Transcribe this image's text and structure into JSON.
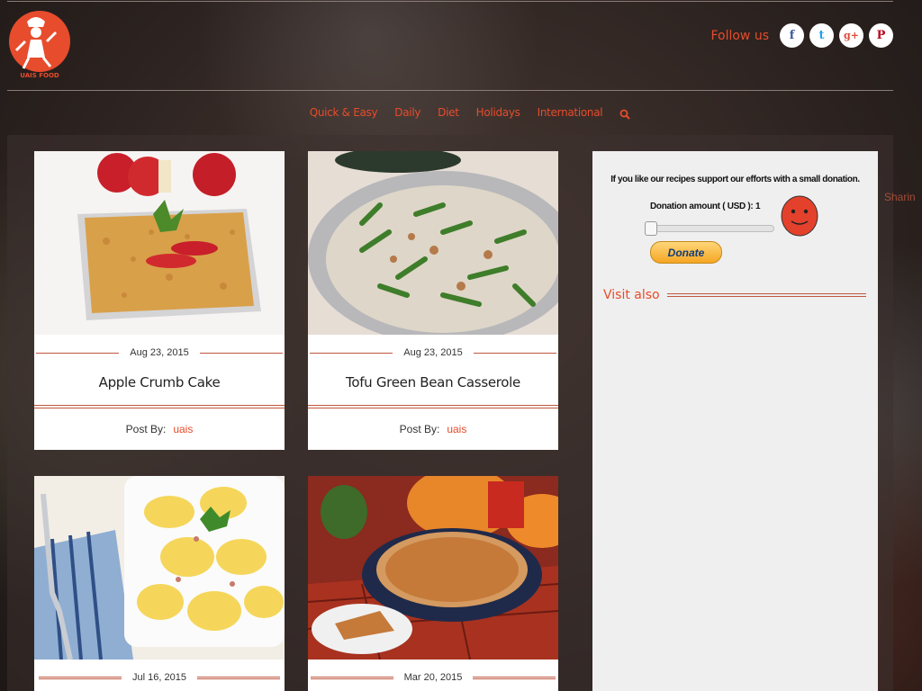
{
  "header": {
    "logo_text": "UAIS FOOD RECIPES",
    "follow_label": "Follow us",
    "social": [
      {
        "name": "facebook",
        "glyph": "f",
        "color": "#3b5998"
      },
      {
        "name": "twitter",
        "glyph": "t",
        "color": "#1da1f2"
      },
      {
        "name": "google-plus",
        "glyph": "g+",
        "color": "#dd4b39"
      },
      {
        "name": "pinterest",
        "glyph": "P",
        "color": "#bd081c"
      }
    ]
  },
  "nav": {
    "items": [
      "Quick & Easy",
      "Daily",
      "Diet",
      "Holidays",
      "International"
    ]
  },
  "posts": [
    {
      "date": "Aug 23, 2015",
      "title": "Apple Crumb Cake",
      "post_by": "Post By:",
      "author": "uais"
    },
    {
      "date": "Aug 23, 2015",
      "title": "Tofu Green Bean Casserole",
      "post_by": "Post By:",
      "author": "uais"
    },
    {
      "date": "Jul 16, 2015"
    },
    {
      "date": "Mar 20, 2015"
    }
  ],
  "sidebar": {
    "donate_text": "If you like our recipes support our efforts with a small donation.",
    "donation_label": "Donation amount ( USD ):",
    "donation_value": "1",
    "donate_button": "Donate",
    "visit_also": "Visit also"
  },
  "sharing_label": "Sharin",
  "colors": {
    "accent": "#e74c2c",
    "sidebar_bg": "#efefef"
  }
}
